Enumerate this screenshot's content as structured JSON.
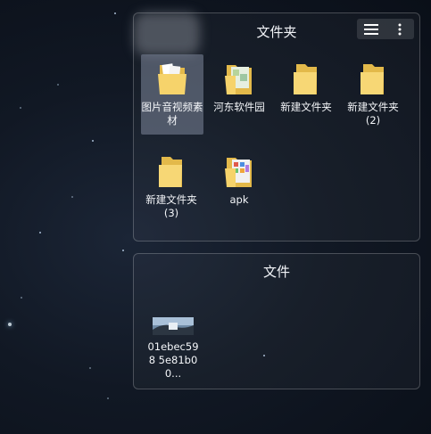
{
  "folders_panel": {
    "title": "文件夹",
    "items": [
      {
        "label": "图片音视频素材",
        "icon": "folder-docs-icon",
        "selected": true
      },
      {
        "label": "河东软件园",
        "icon": "folder-image-icon",
        "selected": false
      },
      {
        "label": "新建文件夹",
        "icon": "folder-icon",
        "selected": false
      },
      {
        "label": "新建文件夹 (2)",
        "icon": "folder-icon",
        "selected": false
      },
      {
        "label": "新建文件夹 (3)",
        "icon": "folder-icon",
        "selected": false
      },
      {
        "label": "apk",
        "icon": "folder-image-icon",
        "selected": false
      }
    ],
    "toolbar": {
      "menu_icon": "hamburger-menu-icon",
      "more_icon": "kebab-more-icon"
    }
  },
  "files_panel": {
    "title": "文件",
    "items": [
      {
        "label": "01ebec598 5e81b00...",
        "icon": "image-thumbnail-icon"
      }
    ]
  },
  "colors": {
    "background": "#111824",
    "folder_yellow": "#f6d36b",
    "panel_border": "rgba(255,255,255,0.22)",
    "selected": "#7d879b"
  }
}
